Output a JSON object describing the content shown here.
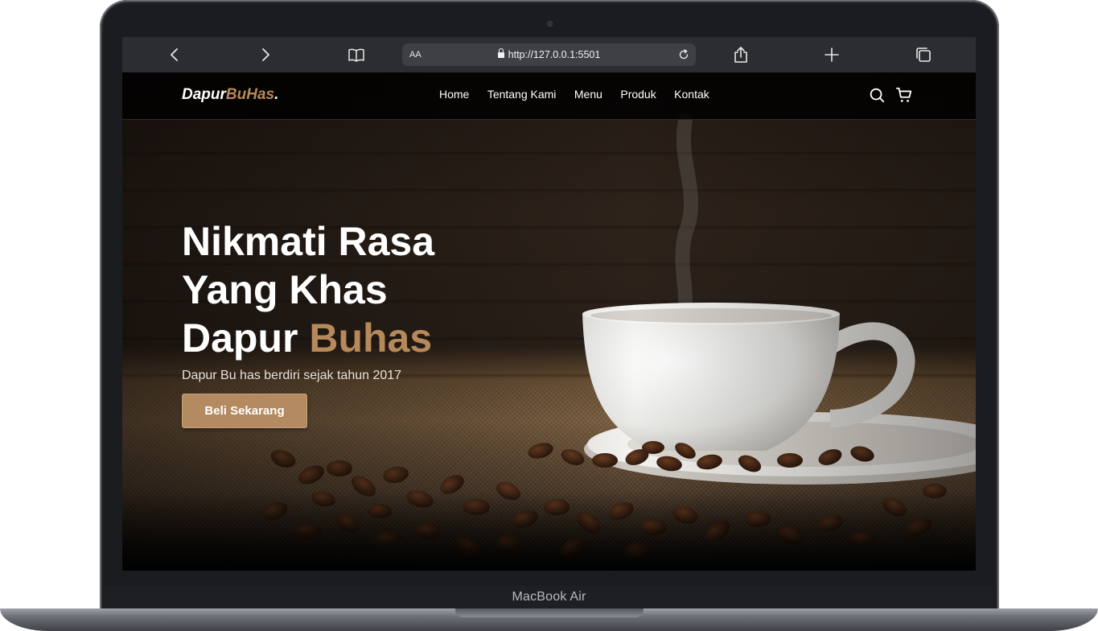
{
  "device": {
    "model_label": "MacBook Air"
  },
  "browser": {
    "text_size_label": "AA",
    "url": "http://127.0.0.1:5501",
    "icons": [
      "back-icon",
      "forward-icon",
      "reader-icon",
      "lock-icon",
      "reload-icon",
      "share-icon",
      "new-tab-icon",
      "tabs-icon"
    ]
  },
  "site": {
    "logo_part1": "Dapur",
    "logo_part2": "BuHas",
    "logo_dot": ".",
    "nav": [
      "Home",
      "Tentang Kami",
      "Menu",
      "Produk",
      "Kontak"
    ],
    "icons": [
      "search-icon",
      "cart-icon"
    ],
    "hero": {
      "line1": "Nikmati Rasa",
      "line2": "Yang Khas",
      "line3_plain": "Dapur ",
      "line3_accent": "Buhas",
      "subtitle": "Dapur Bu has berdiri sejak tahun 2017",
      "cta": "Beli Sekarang"
    },
    "colors": {
      "accent": "#b6895b",
      "button": "#b48a60",
      "nav_bg": "#000000"
    }
  }
}
